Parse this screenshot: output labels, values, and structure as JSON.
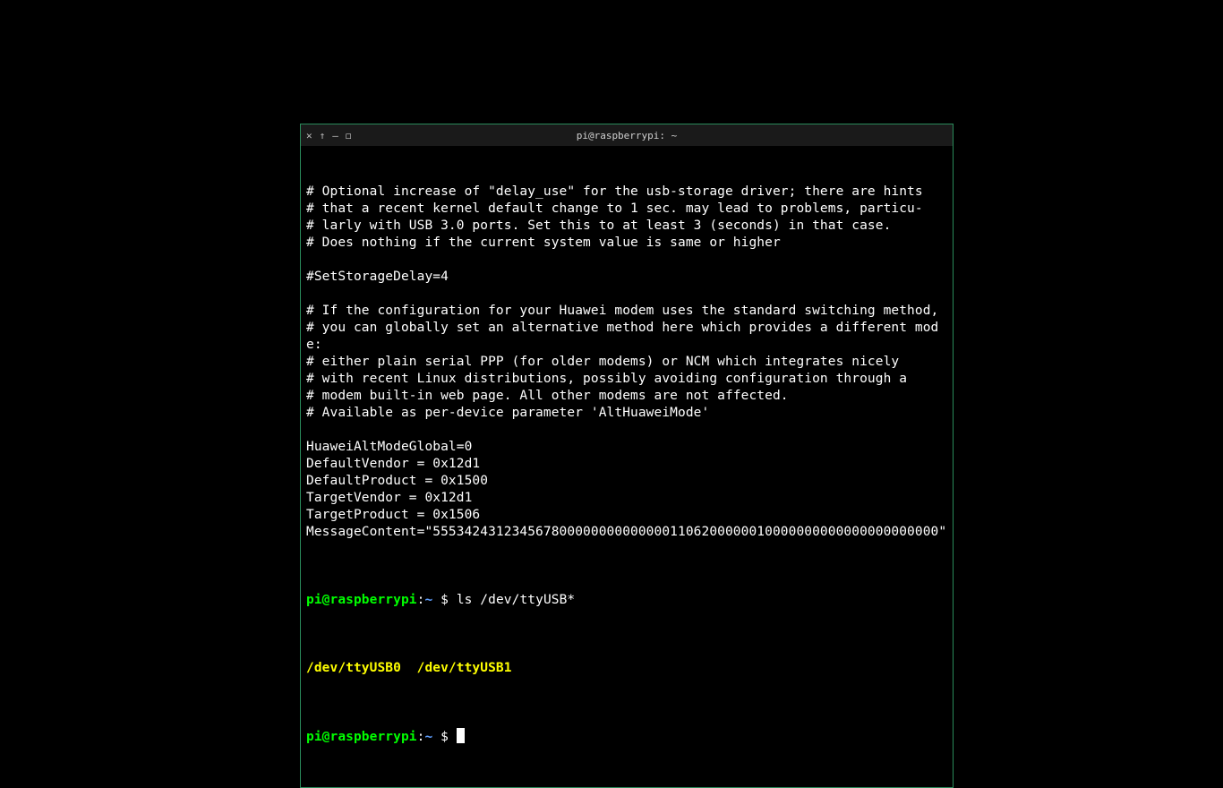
{
  "window": {
    "title": "pi@raspberrypi: ~"
  },
  "colors": {
    "prompt_user": "#00ff00",
    "prompt_path": "#5f9fff",
    "ls_output": "#ffff00",
    "fg": "#ffffff",
    "bg": "#000000",
    "border": "#2a8a5a"
  },
  "config_lines": [
    "# Optional increase of \"delay_use\" for the usb-storage driver; there are hints",
    "# that a recent kernel default change to 1 sec. may lead to problems, particu-",
    "# larly with USB 3.0 ports. Set this to at least 3 (seconds) in that case.",
    "# Does nothing if the current system value is same or higher",
    "",
    "#SetStorageDelay=4",
    "",
    "# If the configuration for your Huawei modem uses the standard switching method,",
    "# you can globally set an alternative method here which provides a different mode:",
    "# either plain serial PPP (for older modems) or NCM which integrates nicely",
    "# with recent Linux distributions, possibly avoiding configuration through a",
    "# modem built-in web page. All other modems are not affected.",
    "# Available as per-device parameter 'AltHuaweiMode'",
    "",
    "HuaweiAltModeGlobal=0",
    "DefaultVendor = 0x12d1",
    "DefaultProduct = 0x1500",
    "TargetVendor = 0x12d1",
    "TargetProduct = 0x1506",
    "MessageContent=\"5553424312345678000000000000001106200000010000000000000000000000\""
  ],
  "prompt": {
    "user_host": "pi@raspberrypi",
    "colon": ":",
    "cwd": "~",
    "dollar": " $ "
  },
  "command1": "ls /dev/ttyUSB*",
  "ls_output": "/dev/ttyUSB0  /dev/ttyUSB1",
  "command2": ""
}
